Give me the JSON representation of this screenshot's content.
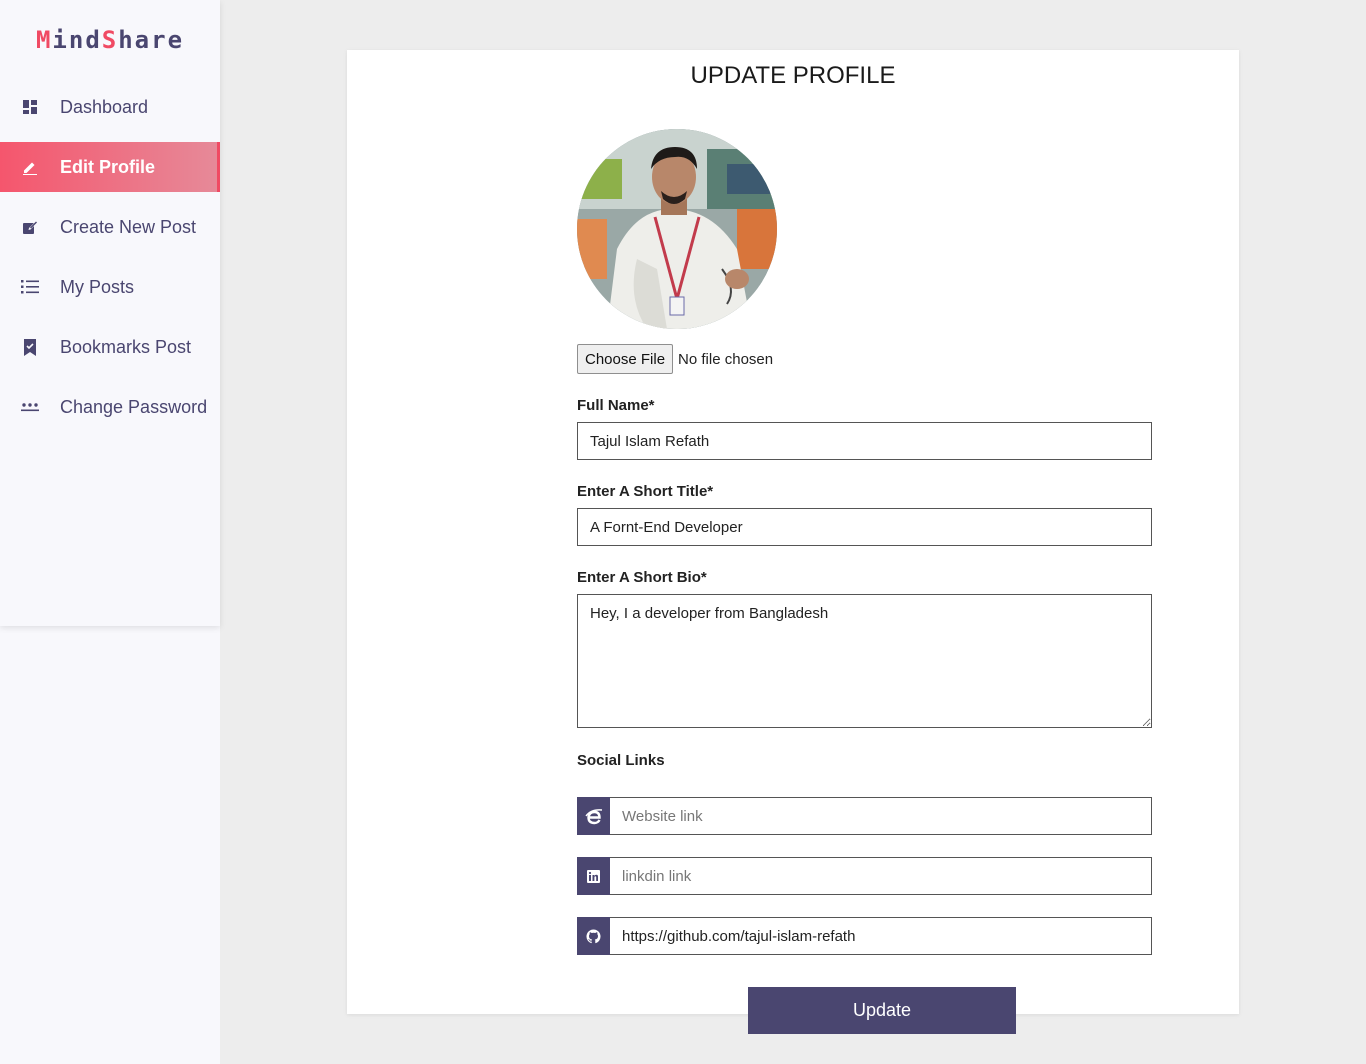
{
  "brand": {
    "part1": "M",
    "part2": "ind",
    "part3": "S",
    "part4": "hare"
  },
  "sidebar": {
    "items": [
      {
        "label": "Dashboard",
        "icon": "dashboard-icon"
      },
      {
        "label": "Edit Profile",
        "icon": "pencil-icon",
        "active": true
      },
      {
        "label": "Create New Post",
        "icon": "edit-square-icon"
      },
      {
        "label": "My Posts",
        "icon": "list-icon"
      },
      {
        "label": "Bookmarks Post",
        "icon": "bookmark-icon"
      },
      {
        "label": "Change Password",
        "icon": "password-icon"
      }
    ]
  },
  "form": {
    "title": "UPDATE PROFILE",
    "file_button": "Choose File",
    "file_status": "No file chosen",
    "full_name_label": "Full Name*",
    "full_name_value": "Tajul Islam Refath",
    "short_title_label": "Enter A Short Title*",
    "short_title_value": "A Fornt-End Developer",
    "short_bio_label": "Enter A Short Bio*",
    "short_bio_value": "Hey, I a developer from Bangladesh",
    "social_links_label": "Social Links",
    "website_placeholder": "Website link",
    "website_value": "",
    "linkedin_placeholder": "linkdin link",
    "linkedin_value": "",
    "github_placeholder": "",
    "github_value": "https://github.com/tajul-islam-refath",
    "update_label": "Update"
  },
  "colors": {
    "accent": "#f04a63",
    "primary": "#4a4670"
  }
}
